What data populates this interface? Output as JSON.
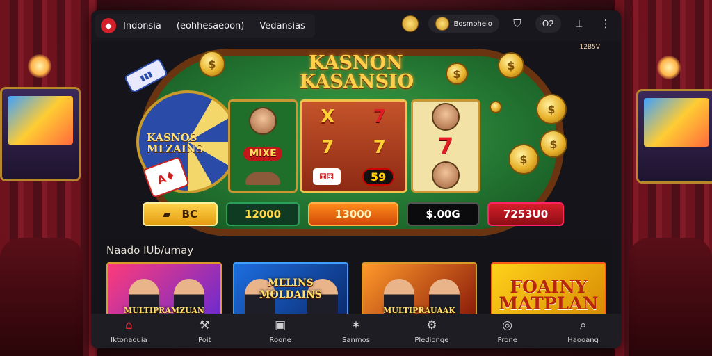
{
  "header": {
    "region": "Indonsia",
    "tagline": "(eohhesaeoon)",
    "tab": "Vedansias",
    "balance_label": "Bosmoheio",
    "counter": "O2",
    "sub_badge": "12B5V"
  },
  "table": {
    "title_line1": "KASNON",
    "title_line2": "KASANSIO",
    "wheel_label_line1": "KASNOS",
    "wheel_label_line2": "MLZAINS"
  },
  "reels": {
    "left_symbol": "MIXE",
    "center_top": [
      "X",
      "7"
    ],
    "center_mid": [
      "7",
      "7"
    ],
    "center_bottom": "59",
    "right_mid": "7"
  },
  "bets": [
    {
      "label": "BC",
      "color": "#ffd24a"
    },
    {
      "label": "12000",
      "color": "#0f3b22"
    },
    {
      "label": "13000",
      "color": "#ff8b1a"
    },
    {
      "label": "$.00G",
      "color": "#0b0b0e"
    },
    {
      "label": "7253U0",
      "color": "#d61f2a"
    }
  ],
  "section": {
    "title": "Naado IUb/umay"
  },
  "games": [
    {
      "title": "MULTIPRAMZUAN"
    },
    {
      "title": "MELINS MOLDAINS"
    },
    {
      "title": "MULTIPRAUAAK"
    },
    {
      "title_line1": "FOAINY",
      "title_line2": "MATPLAN"
    }
  ],
  "nav": [
    {
      "label": "Iktonaouia",
      "icon": "home-icon"
    },
    {
      "label": "Poit",
      "icon": "wrench-icon"
    },
    {
      "label": "Roone",
      "icon": "square-icon"
    },
    {
      "label": "Sanmos",
      "icon": "star-person-icon"
    },
    {
      "label": "Pledionge",
      "icon": "gear-icon"
    },
    {
      "label": "Prone",
      "icon": "chat-icon"
    },
    {
      "label": "Haooang",
      "icon": "search-icon"
    }
  ],
  "accent": "#e0242f"
}
